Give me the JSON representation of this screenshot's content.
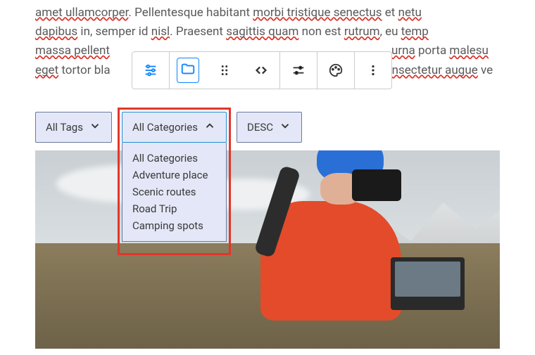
{
  "text": {
    "line1_a": "amet ullamcorper",
    "line1_b": ". Pellentesque habitant ",
    "line1_c": "morbi tristique senectus",
    "line1_d": " et ",
    "line1_e": "netu",
    "line2_a": "dapibus",
    "line2_b": " in, semper id ",
    "line2_c": "nisl",
    "line2_d": ". Praesent ",
    "line2_e": "sagittis quam",
    "line2_f": " non est ",
    "line2_g": "rutrum",
    "line2_h": ", eu ",
    "line2_i": "temp",
    "line3_a": "massa pellent",
    "line3_b": "urna",
    "line3_c": " porta ",
    "line3_d": "malesu",
    "line4_a": "eget",
    "line4_b": " tortor bla",
    "line4_c": "nsectetur augue",
    "line4_d": " ve"
  },
  "filters": {
    "tags_label": "All Tags",
    "categories_label": "All Categories",
    "sort_label": "DESC"
  },
  "dropdown": {
    "items": [
      "All Categories",
      "Adventure place",
      "Scenic routes",
      "Road Trip",
      "Camping spots"
    ]
  }
}
